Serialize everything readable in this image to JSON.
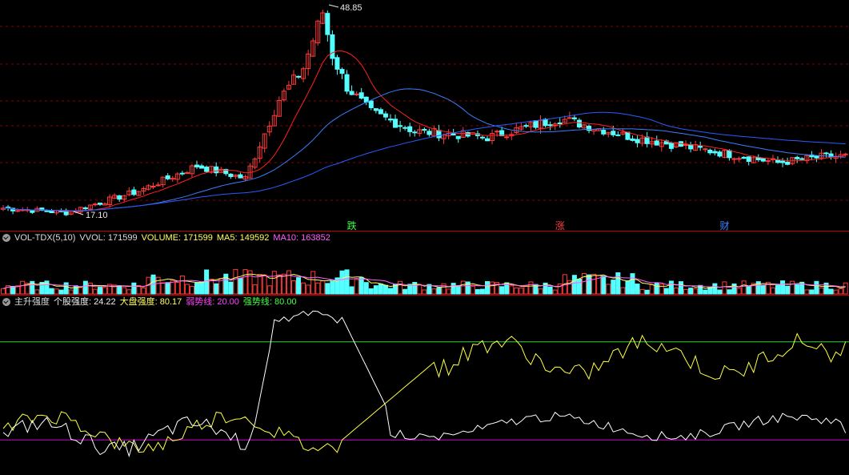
{
  "colors": {
    "up": "#ff3b3b",
    "down": "#54ffff",
    "ma_short": "#ff2020",
    "ma_long1": "#3a7fff",
    "ma_long2": "#2a5cff",
    "grid": "#8a0000",
    "vol_ma5": "#ffff60",
    "vol_ma10": "#ff60ff",
    "weak": "#d000d0",
    "strong": "#40d040",
    "white": "#ffffff",
    "yellow": "#ffff40"
  },
  "price_panel": {
    "high_label": "48.85",
    "low_label": "17.10",
    "events": [
      {
        "text": "跌",
        "color": "#40ff40",
        "index": 72
      },
      {
        "text": "涨",
        "color": "#ff4040",
        "index": 115
      },
      {
        "text": "财",
        "color": "#4080ff",
        "index": 149
      }
    ]
  },
  "volume_header": {
    "name": "VOL-TDX(5,10)",
    "vvol": "VVOL: 171599",
    "volume": "VOLUME: 171599",
    "ma5": "MA5: 149592",
    "ma10": "MA10: 163852"
  },
  "indicator_header": {
    "name": "主升强度",
    "stock": "个股强度: 24.22",
    "market": "大盘强度: 80.17",
    "weak": "弱势线: 20.00",
    "strong": "强势线: 80.00"
  },
  "chart_data": [
    {
      "type": "candlestick",
      "ylim": [
        16,
        50
      ],
      "key_points": {
        "index": [
          0,
          13,
          28,
          40,
          50,
          57,
          62,
          66,
          68,
          71,
          76,
          85,
          100,
          115,
          125,
          130,
          145,
          160,
          170
        ],
        "close": [
          17.8,
          17.1,
          20.5,
          24.5,
          22.5,
          35,
          40,
          48.85,
          42,
          37,
          33,
          30,
          29,
          32,
          30,
          29,
          27,
          25,
          26
        ]
      },
      "ma_short_label": "",
      "ma_long1_label": "",
      "ma_long2_label": ""
    },
    {
      "type": "bar",
      "name": "VOLUME",
      "ylim": [
        0,
        200000
      ],
      "latest": {
        "vvol": 171599,
        "ma5": 149592,
        "ma10": 163852
      }
    },
    {
      "type": "line",
      "ylim": [
        0,
        100
      ],
      "reference_lines": [
        {
          "name": "弱势线",
          "value": 20
        },
        {
          "name": "强势线",
          "value": 80
        }
      ],
      "latest": {
        "stock_strength": 24.22,
        "market_strength": 80.17
      }
    }
  ]
}
